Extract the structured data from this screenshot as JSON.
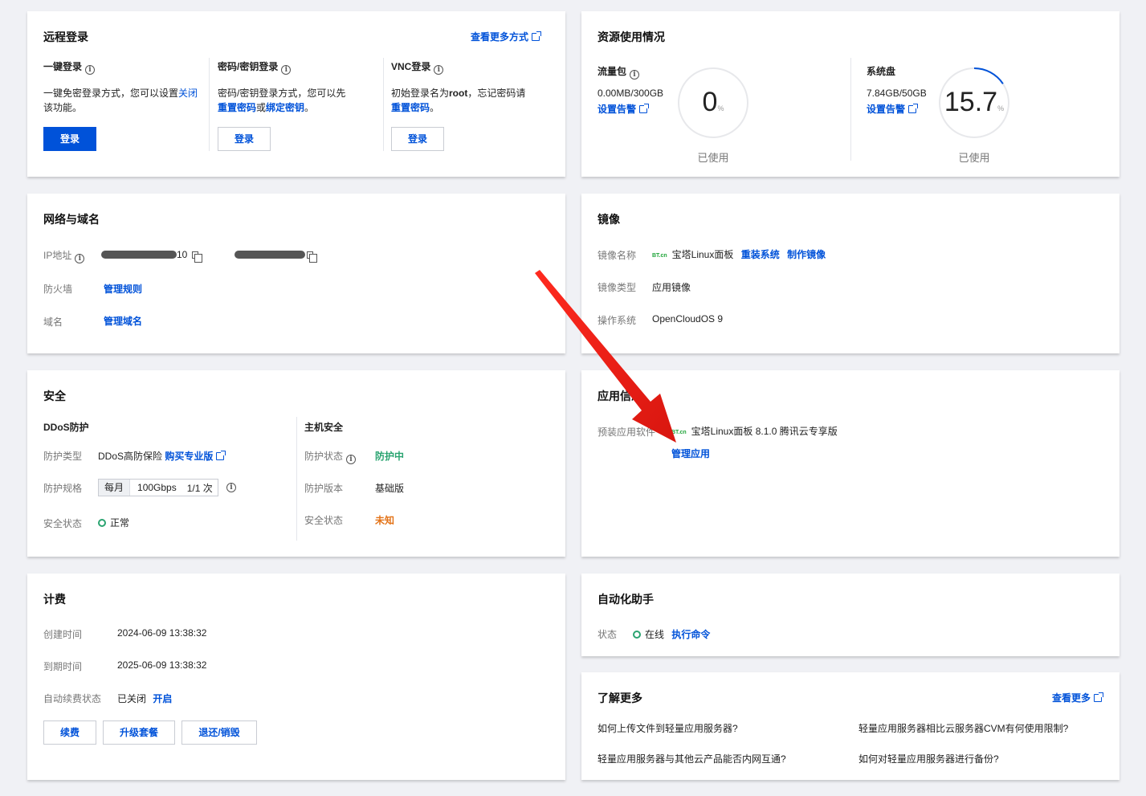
{
  "remote": {
    "title": "远程登录",
    "more": "查看更多方式",
    "one_click": {
      "title": "一键登录",
      "desc1": "一键免密登录方式，您可以设置",
      "desc_link": "关闭",
      "desc2": "该功能。",
      "btn": "登录"
    },
    "pwd": {
      "title": "密码/密钥登录",
      "desc1": "密码/密钥登录方式，您可以先",
      "link1": "重置密码",
      "or": "或",
      "link2": "绑定密钥",
      "end": "。",
      "btn": "登录"
    },
    "vnc": {
      "title": "VNC登录",
      "desc1": "初始登录名为",
      "root": "root",
      "desc2": "，忘记密码请",
      "link": "重置密码",
      "end": "。",
      "btn": "登录"
    }
  },
  "resources": {
    "title": "资源使用情况",
    "traffic": {
      "title": "流量包",
      "value": "0.00MB/300GB",
      "alarm": "设置告警",
      "percent": "0",
      "unit": "%",
      "used": "已使用",
      "fraction": 0
    },
    "disk": {
      "title": "系统盘",
      "value": "7.84GB/50GB",
      "alarm": "设置告警",
      "percent": "15.7",
      "unit": "%",
      "used": "已使用",
      "fraction": 0.157
    }
  },
  "network": {
    "title": "网络与域名",
    "ip_label": "IP地址",
    "ip1_suffix": "10",
    "firewall_label": "防火墙",
    "firewall_link": "管理规则",
    "domain_label": "域名",
    "domain_link": "管理域名"
  },
  "image": {
    "title": "镜像",
    "name_label": "镜像名称",
    "logo": "BT.cn",
    "name": "宝塔Linux面板",
    "reinstall": "重装系统",
    "make": "制作镜像",
    "type_label": "镜像类型",
    "type": "应用镜像",
    "os_label": "操作系统",
    "os": "OpenCloudOS 9"
  },
  "security": {
    "title": "安全",
    "ddos": {
      "title": "DDoS防护",
      "type_label": "防护类型",
      "type": "DDoS高防保险",
      "buy": "购买专业版",
      "spec_label": "防护规格",
      "spec": [
        "每月",
        "100Gbps",
        "1/1 次"
      ],
      "status_label": "安全状态",
      "status": "正常"
    },
    "host": {
      "title": "主机安全",
      "prot_label": "防护状态",
      "prot": "防护中",
      "ver_label": "防护版本",
      "ver": "基础版",
      "status_label": "安全状态",
      "status": "未知"
    }
  },
  "app": {
    "title": "应用信息",
    "software_label": "预装应用软件",
    "logo": "BT.cn",
    "software": "宝塔Linux面板 8.1.0 腾讯云专享版",
    "manage": "管理应用"
  },
  "billing": {
    "title": "计费",
    "created_label": "创建时间",
    "created": "2024-06-09 13:38:32",
    "expire_label": "到期时间",
    "expire": "2025-06-09 13:38:32",
    "renew_label": "自动续费状态",
    "renew": "已关闭",
    "renew_link": "开启",
    "buttons": [
      "续费",
      "升级套餐",
      "退还/销毁"
    ]
  },
  "automation": {
    "title": "自动化助手",
    "status_label": "状态",
    "status": "在线",
    "exec": "执行命令"
  },
  "learn": {
    "title": "了解更多",
    "more": "查看更多",
    "q1": "如何上传文件到轻量应用服务器?",
    "q2": "轻量应用服务器相比云服务器CVM有何使用限制?",
    "q3": "轻量应用服务器与其他云产品能否内网互通?",
    "q4": "如何对轻量应用服务器进行备份?"
  },
  "colors": {
    "primary": "#0052d9",
    "success": "#2ba471",
    "warning": "#e37318",
    "arrow": "#e5211a"
  }
}
